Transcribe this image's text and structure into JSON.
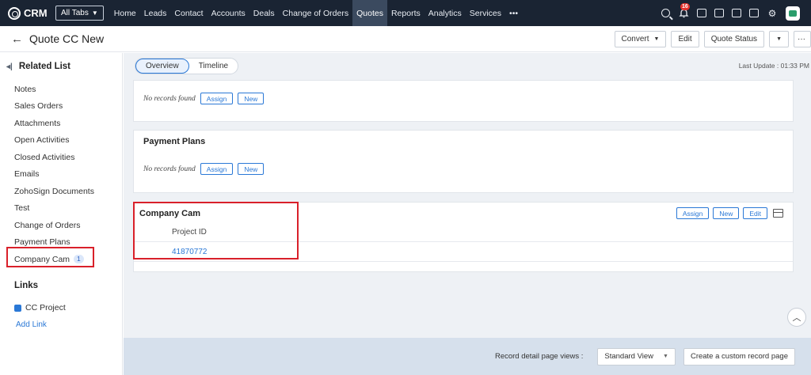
{
  "nav": {
    "app_name": "CRM",
    "all_tabs": "All Tabs",
    "links": [
      "Home",
      "Leads",
      "Contact",
      "Accounts",
      "Deals",
      "Change of Orders",
      "Quotes",
      "Reports",
      "Analytics",
      "Services",
      "•••"
    ],
    "active_link": "Quotes",
    "notification_count": "16"
  },
  "header": {
    "back_arrow": "←",
    "title": "Quote CC New",
    "convert_label": "Convert",
    "edit_label": "Edit",
    "quote_status_label": "Quote Status",
    "more_label": "···"
  },
  "sidebar": {
    "title": "Related List",
    "items": [
      {
        "label": "Notes"
      },
      {
        "label": "Sales Orders"
      },
      {
        "label": "Attachments"
      },
      {
        "label": "Open Activities"
      },
      {
        "label": "Closed Activities"
      },
      {
        "label": "Emails"
      },
      {
        "label": "ZohoSign Documents"
      },
      {
        "label": "Test"
      },
      {
        "label": "Change of Orders"
      },
      {
        "label": "Payment Plans"
      },
      {
        "label": "Company Cam",
        "count": "1"
      }
    ],
    "links_title": "Links",
    "link_item": "CC Project",
    "add_link": "Add Link"
  },
  "main": {
    "tabs": [
      "Overview",
      "Timeline"
    ],
    "last_update": "Last Update : 01:33 PM",
    "top_card": {
      "no_records": "No records found",
      "assign": "Assign",
      "new": "New"
    },
    "payment_plans": {
      "title": "Payment Plans",
      "no_records": "No records found",
      "assign": "Assign",
      "new": "New"
    },
    "company_cam": {
      "title": "Company Cam",
      "assign": "Assign",
      "new": "New",
      "edit": "Edit",
      "column": "Project ID",
      "value": "41870772"
    }
  },
  "footer": {
    "label": "Record detail page views :",
    "view_select": "Standard View",
    "custom_button": "Create a custom record page"
  }
}
